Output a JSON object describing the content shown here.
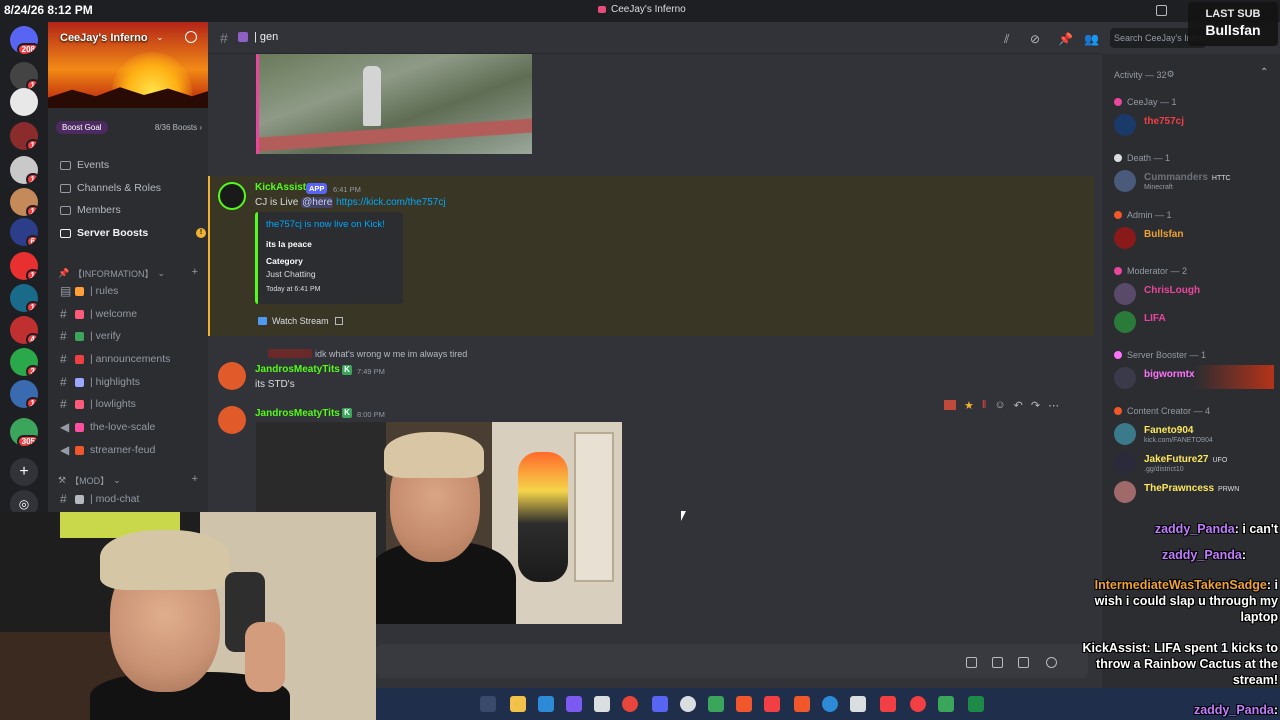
{
  "titlebar": {
    "datetime": "8/24/26 8:12 PM",
    "window_title": "CeeJay's Inferno"
  },
  "server": {
    "name": "CeeJay's Inferno",
    "boost_goal": "Boost Goal",
    "boost_count": "8/36 Boosts"
  },
  "rail_badges": [
    "208",
    "1",
    "1",
    "1",
    "1",
    "6",
    "1",
    "1",
    "4",
    "3",
    "1",
    "305"
  ],
  "sidebar_menu": [
    {
      "label": "Events",
      "icon": "calendar-icon"
    },
    {
      "label": "Channels & Roles",
      "icon": "list-icon"
    },
    {
      "label": "Members",
      "icon": "members-icon"
    },
    {
      "label": "Server Boosts",
      "icon": "boost-icon"
    }
  ],
  "categories": {
    "info": "【INFORMATION】",
    "mod": "【MOD】"
  },
  "channels": [
    {
      "label": "| rules",
      "color": "#ff9f3a"
    },
    {
      "label": "| welcome",
      "color": "#ff5a7a"
    },
    {
      "label": "| verify",
      "color": "#3ba55c"
    },
    {
      "label": "| announcements",
      "color": "#f23f43"
    },
    {
      "label": "| highlights",
      "color": "#9aa6ff"
    },
    {
      "label": "| lowlights",
      "color": "#ff5a7a"
    },
    {
      "label": "the-love-scale",
      "color": "#ff4fa3"
    },
    {
      "label": "streamer-feud",
      "color": "#f0572b"
    }
  ],
  "mod_channels": [
    {
      "label": "| mod-chat",
      "color": "#b5bac1"
    }
  ],
  "header": {
    "channel": "| gen",
    "search_placeholder": "Search CeeJay's Inferno"
  },
  "messages": {
    "kick": {
      "author": "KickAssist",
      "app_tag": "APP",
      "time": "6:41 PM",
      "text_pre": "CJ is Live",
      "mention": "@here",
      "link": "https://kick.com/the757cj",
      "embed": {
        "title": "the757cj is now live on Kick!",
        "subtitle": "its la peace",
        "field_name": "Category",
        "field_value": "Just Chatting",
        "footer": "Today at 6:41 PM"
      },
      "button": "Watch Stream"
    },
    "jandros1": {
      "reply_text": "idk what's wrong w me im always tired",
      "author": "JandrosMeatyTits",
      "time": "7:49 PM",
      "text": "its STD's"
    },
    "jandros2": {
      "author": "JandrosMeatyTits",
      "time": "8:00 PM"
    }
  },
  "members": {
    "activity": "Activity — 32",
    "groups": [
      {
        "header": "CeeJay — 1",
        "color": "#eb459e",
        "rows": [
          {
            "name": "the757cj",
            "color": "#f23f43"
          }
        ]
      },
      {
        "header": "Death — 1",
        "color": "#dbdee1",
        "rows": [
          {
            "name": "Cummanders",
            "color": "#6d7178",
            "tag": "HTTC",
            "sub": "Minecraft"
          }
        ]
      },
      {
        "header": "Admin — 1",
        "color": "#f0572b",
        "rows": [
          {
            "name": "Bullsfan",
            "color": "#f0a232"
          }
        ]
      },
      {
        "header": "Moderator — 2",
        "color": "#eb459e",
        "rows": [
          {
            "name": "ChrisLough",
            "color": "#eb459e"
          },
          {
            "name": "LIFA",
            "color": "#eb459e"
          }
        ]
      },
      {
        "header": "Server Booster — 1",
        "color": "#ff73fa",
        "rows": [
          {
            "name": "bigwormtx",
            "color": "#ff73fa"
          }
        ]
      },
      {
        "header": "Content Creator — 4",
        "color": "#f0572b",
        "rows": [
          {
            "name": "Faneto904",
            "color": "#fee75c",
            "sub": "kick.com/FANETO904"
          },
          {
            "name": "JakeFuture27",
            "color": "#fee75c",
            "tag": "UFO",
            "sub": ".gg/district10"
          },
          {
            "name": "ThePrawncess",
            "color": "#fee75c",
            "tag": "PRWN"
          }
        ]
      }
    ]
  },
  "overlay": {
    "last_sub_label": "LAST SUB",
    "last_sub_name": "Bullsfan",
    "chat": [
      {
        "user": "zaddy_Panda",
        "text": "i can't",
        "color": "#c17cff"
      },
      {
        "user": "zaddy_Panda",
        "text": "",
        "color": "#c17cff"
      },
      {
        "user": "IntermediateWasTakenSadge",
        "text": "i wish i could slap u through my laptop",
        "color": "#f0a232"
      },
      {
        "user": "KickAssist",
        "text": "LIFA spent 1 kicks to throw a Rainbow Cactus at the stream!",
        "color": "#dbdee1"
      },
      {
        "user": "zaddy_Panda",
        "text": "",
        "color": "#c17cff"
      }
    ]
  },
  "taskbar": {
    "time": "8:12 PM",
    "date": "8/24/2026"
  }
}
